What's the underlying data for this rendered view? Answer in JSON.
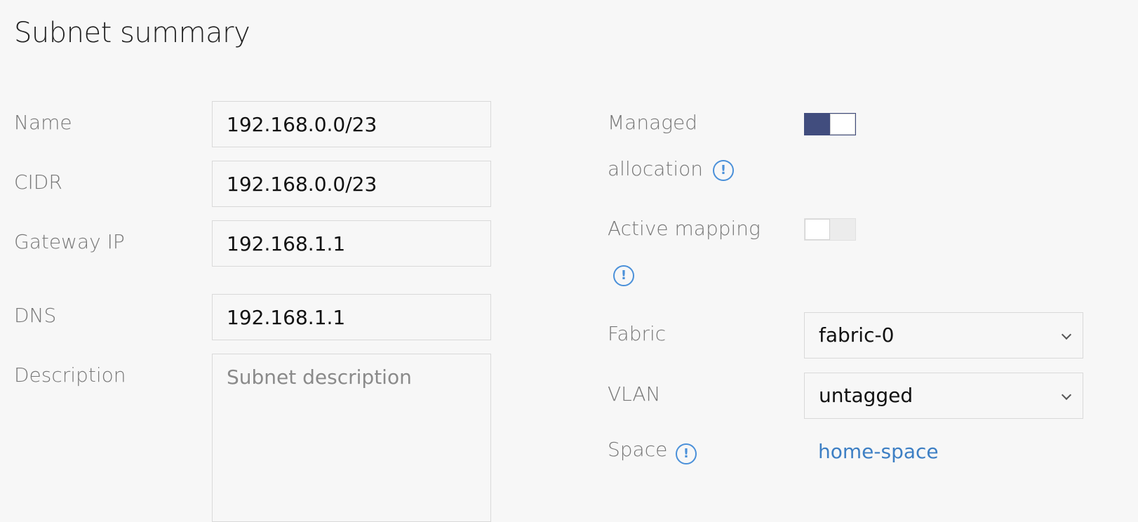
{
  "page": {
    "title": "Subnet summary"
  },
  "form": {
    "name": {
      "label": "Name",
      "value": "192.168.0.0/23"
    },
    "cidr": {
      "label": "CIDR",
      "value": "192.168.0.0/23"
    },
    "gateway": {
      "label": "Gateway IP",
      "value": "192.168.1.1"
    },
    "dns": {
      "label": "DNS",
      "value": "192.168.1.1"
    },
    "description": {
      "label": "Description",
      "value": "",
      "placeholder": "Subnet description"
    }
  },
  "settings": {
    "managed_allocation": {
      "label_line1": "Managed",
      "label_line2": "allocation",
      "enabled": true
    },
    "active_mapping": {
      "label": "Active mapping",
      "enabled": false
    },
    "fabric": {
      "label": "Fabric",
      "value": "fabric-0"
    },
    "vlan": {
      "label": "VLAN",
      "value": "untagged"
    },
    "space": {
      "label": "Space",
      "value": "home-space"
    }
  },
  "icons": {
    "info": "info-icon",
    "dropdown": "chevron-down-icon"
  },
  "colors": {
    "toggle_on": "#414d7e",
    "link": "#3d7fc4",
    "info": "#4a90d9"
  }
}
